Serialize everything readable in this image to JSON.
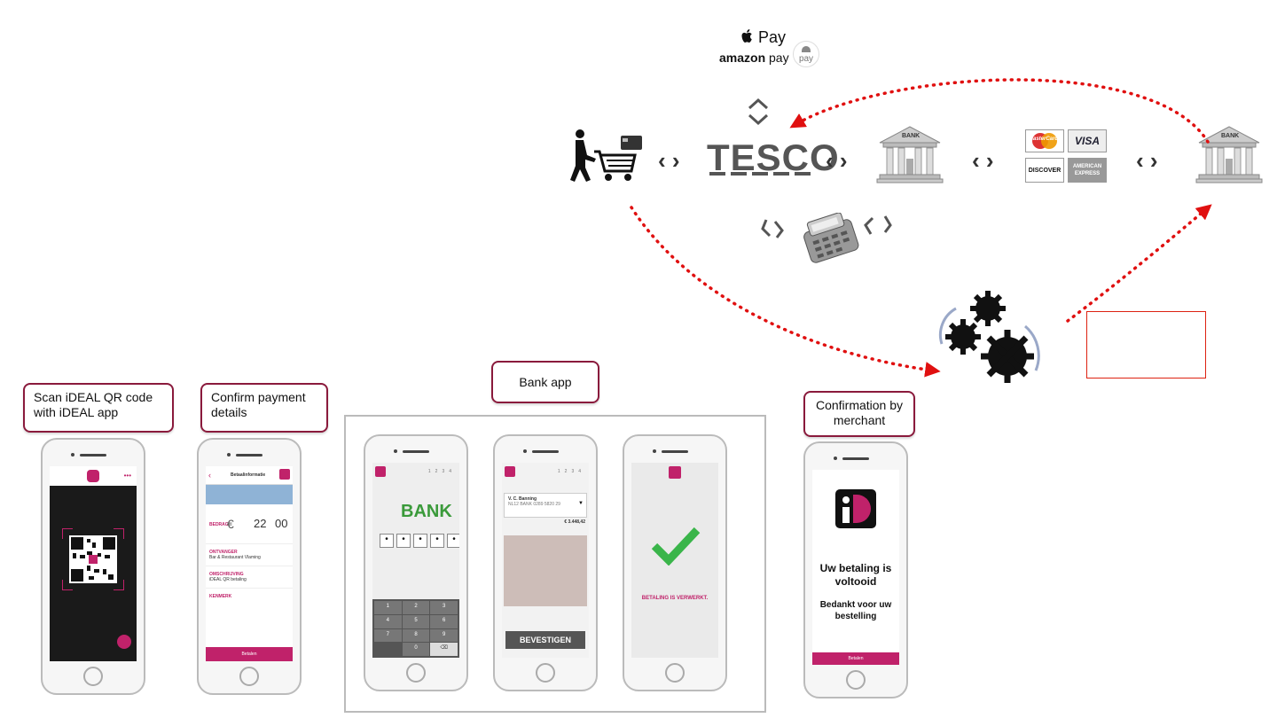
{
  "top": {
    "apple_pay": "Pay",
    "amazon_pay": "amazon",
    "amazon_pay_suffix": "pay",
    "android_pay": "pay",
    "tesco": "TESCO",
    "bank_label_1": "BANK",
    "bank_label_2": "BANK",
    "chevrons": "‹ ›"
  },
  "cards": {
    "mastercard": "MasterCard",
    "visa": "VISA",
    "discover": "DISCOVER",
    "amex": "AMERICAN EXPRESS"
  },
  "steps": {
    "scan": "Scan iDEAL QR code with iDEAL app",
    "confirm": "Confirm payment details",
    "bank_app": "Bank app",
    "merchant": "Confirmation by merchant"
  },
  "phone2": {
    "title": "Betaalinformatie",
    "bedrag_label": "BEDRAG",
    "currency": "€",
    "amount_int": "22",
    "amount_dec": "00",
    "ontvanger_label": "ONTVANGER",
    "ontvanger": "Bar & Restaurant Vlaming",
    "omschrijving_label": "OMSCHRIJVING",
    "omschrijving": "iDEAL QR betaling",
    "kenmerk_label": "KENMERK",
    "button": "Betalen"
  },
  "phone3": {
    "bank": "BANK",
    "steps": [
      "1",
      "2",
      "3",
      "4"
    ],
    "keys": [
      "1",
      "2",
      "3",
      "4",
      "5",
      "6",
      "7",
      "8",
      "9",
      "",
      "0",
      "⌫"
    ]
  },
  "phone4": {
    "name": "V. C. Banning",
    "iban": "NL12 BANK 0289 5820 29",
    "balance": "€ 3.448,42",
    "button": "BEVESTIGEN"
  },
  "phone5": {
    "status": "BETALING IS VERWERKT."
  },
  "phone6": {
    "line1": "Uw betaling is",
    "line2": "voltooid",
    "line3": "Bedankt voor uw",
    "line4": "bestelling",
    "button": "Betalen"
  },
  "colors": {
    "accent": "#c0226a",
    "arrow": "#e01010",
    "border": "#8a1a3c",
    "check": "#3ab54a"
  }
}
